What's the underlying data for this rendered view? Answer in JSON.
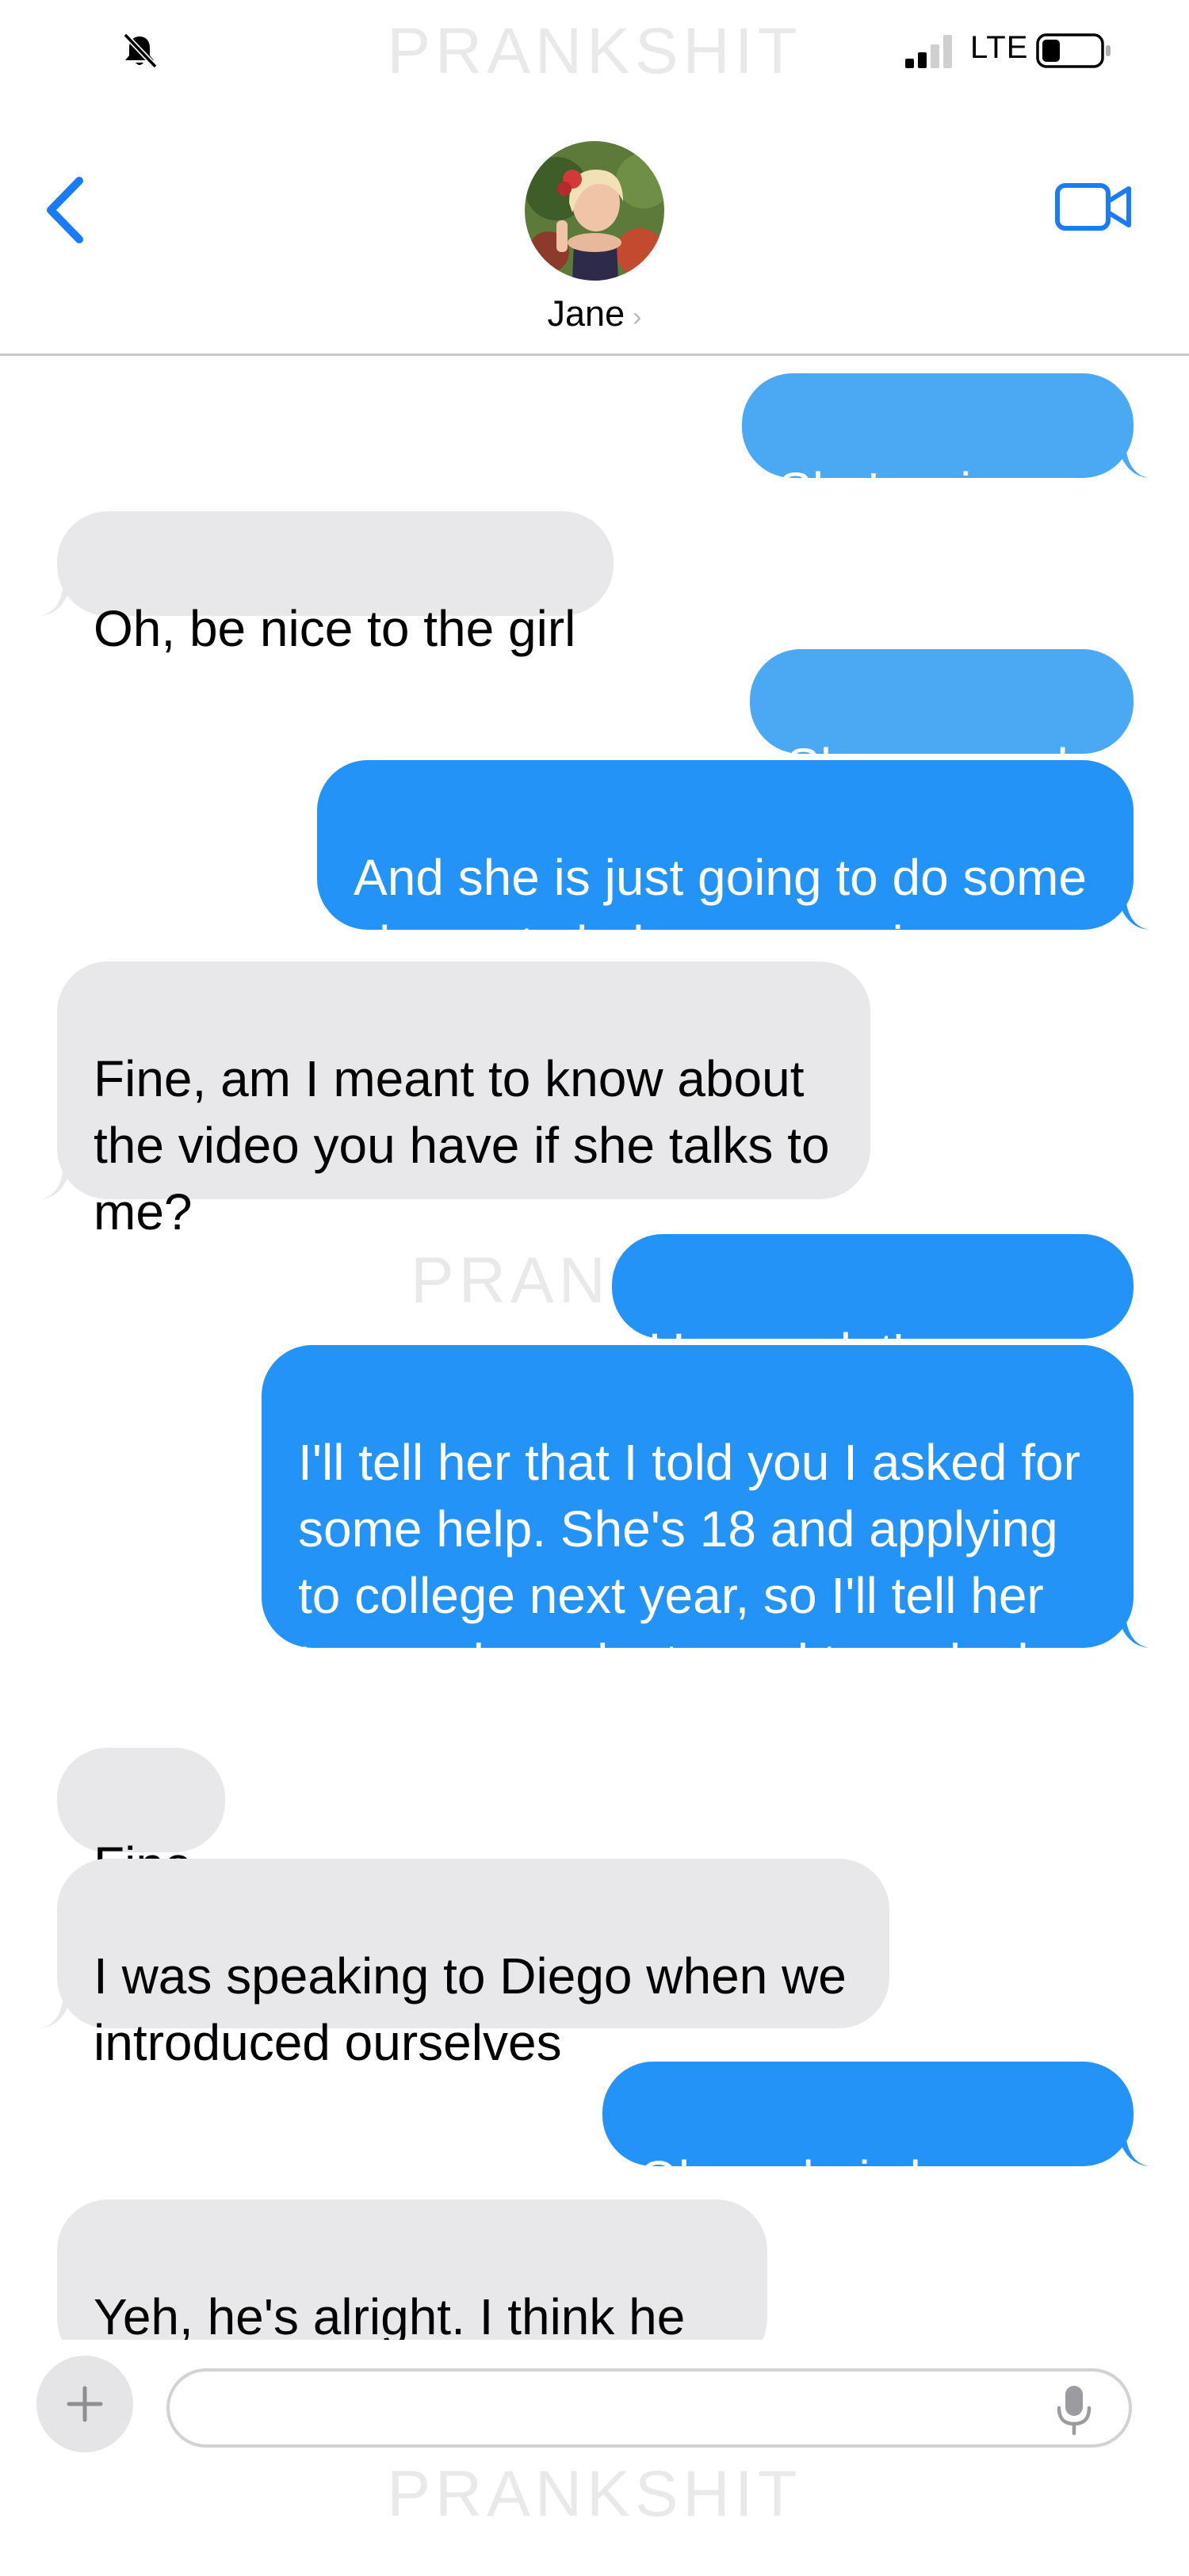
{
  "status_bar": {
    "network": "LTE",
    "watermark": "PRANKSHIT",
    "icons": [
      "bell-slash-icon",
      "signal-bars-icon",
      "battery-icon"
    ]
  },
  "header": {
    "contact_name": "Jane",
    "chevron": "›",
    "icons": [
      "chevron-left-icon",
      "video-camera-icon"
    ]
  },
  "messages": [
    {
      "side": "sent",
      "text": "She's mine xo"
    },
    {
      "side": "received",
      "text": "Oh, be nice to the girl"
    },
    {
      "side": "sent",
      "text": "She was rude"
    },
    {
      "side": "sent",
      "text": "And she is just going to do some\nchores to help us move in"
    },
    {
      "side": "received",
      "text": "Fine, am I meant to know about\nthe video you have if she talks to\nme?"
    },
    {
      "side": "sent",
      "text": "Ummm, let's say no"
    },
    {
      "side": "sent",
      "text": "I'll tell her that I told you I asked for\nsome help. She's 18 and applying\nto college next year, so I'll tell her\nto say she volunteered to make her\napplication better"
    },
    {
      "side": "received",
      "text": "Fine"
    },
    {
      "side": "received",
      "text": "I was speaking to Diego when we\nintroduced ourselves"
    },
    {
      "side": "sent",
      "text": "Oh yeah, is he nice?"
    },
    {
      "side": "received",
      "text": "Yeh, he's alright. I think he is\nslightly older than her"
    }
  ],
  "composer": {
    "add_label": "+",
    "input_value": "",
    "icons": [
      "plus-icon",
      "microphone-icon"
    ]
  },
  "colors": {
    "sent_bubble": "#2393f7",
    "sent_bubble_light": "#4ba8f3",
    "received_bubble": "#e8e8ea",
    "accent": "#1a7cf5"
  }
}
